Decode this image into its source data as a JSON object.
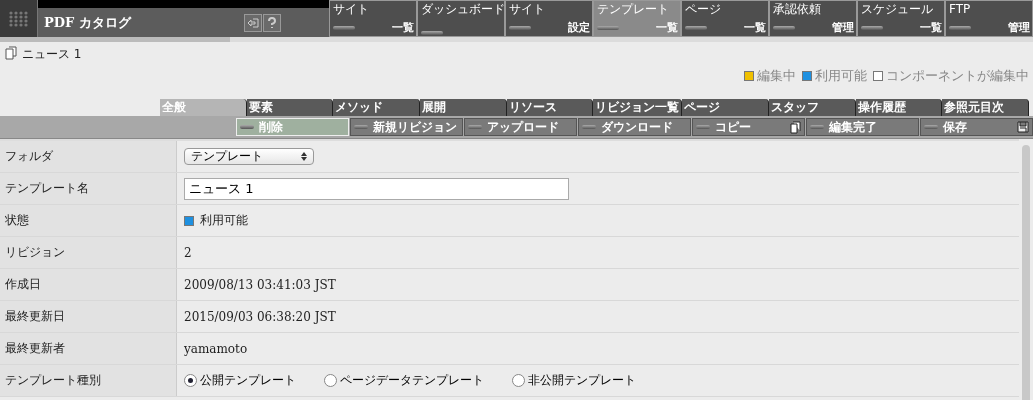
{
  "app": {
    "title": "PDF カタログ"
  },
  "nav": [
    {
      "label": "サイト",
      "sub": "一覧",
      "selected": false
    },
    {
      "label": "ダッシュボード",
      "selected": false
    },
    {
      "label": "サイト",
      "sub": "設定",
      "selected": false
    },
    {
      "label": "テンプレート",
      "sub": "一覧",
      "selected": true
    },
    {
      "label": "ページ",
      "sub": "一覧",
      "selected": false
    },
    {
      "label": "承認依頼",
      "sub": "管理",
      "selected": false
    },
    {
      "label": "スケジュール",
      "sub": "一覧",
      "selected": false
    },
    {
      "label": "FTP",
      "sub": "管理",
      "selected": false
    }
  ],
  "document": {
    "title": "ニュース 1"
  },
  "legend": [
    {
      "label": "編集中",
      "color": "#f0c000"
    },
    {
      "label": "利用可能",
      "color": "#1e90e0"
    },
    {
      "label": "コンポーネントが編集中",
      "color": "#ffffff"
    }
  ],
  "tabs": [
    {
      "label": "全般",
      "selected": true
    },
    {
      "label": "要素",
      "selected": false
    },
    {
      "label": "メソッド",
      "selected": false
    },
    {
      "label": "展開",
      "selected": false
    },
    {
      "label": "リソース",
      "selected": false
    },
    {
      "label": "リビジョン一覧",
      "selected": false
    },
    {
      "label": "ページ",
      "selected": false
    },
    {
      "label": "スタッフ",
      "selected": false
    },
    {
      "label": "操作履歴",
      "selected": false
    },
    {
      "label": "参照元目次",
      "selected": false
    }
  ],
  "actions": [
    {
      "label": "削除",
      "active": true,
      "kind": "plain"
    },
    {
      "label": "新規リビジョン",
      "active": false,
      "kind": "plain"
    },
    {
      "label": "アップロード",
      "active": false,
      "kind": "plain"
    },
    {
      "label": "ダウンロード",
      "active": false,
      "kind": "plain"
    },
    {
      "label": "コピー",
      "active": false,
      "kind": "copy"
    },
    {
      "label": "編集完了",
      "active": false,
      "kind": "plain"
    },
    {
      "label": "保存",
      "active": false,
      "kind": "save"
    }
  ],
  "fields": [
    {
      "kind": "select",
      "label": "フォルダ",
      "value": "テンプレート"
    },
    {
      "kind": "input",
      "label": "テンプレート名",
      "value": "ニュース 1"
    },
    {
      "kind": "status",
      "label": "状態",
      "value": "利用可能",
      "color": "#1e90e0"
    },
    {
      "kind": "text",
      "label": "リビジョン",
      "value": "2"
    },
    {
      "kind": "text",
      "label": "作成日",
      "value": "2009/08/13 03:41:03 JST"
    },
    {
      "kind": "text",
      "label": "最終更新日",
      "value": "2015/09/03 06:38:20 JST"
    },
    {
      "kind": "text",
      "label": "最終更新者",
      "value": "yamamoto"
    },
    {
      "kind": "radio",
      "label": "テンプレート種別",
      "options": [
        {
          "label": "公開テンプレート",
          "selected": true
        },
        {
          "label": "ページデータテンプレート",
          "selected": false
        },
        {
          "label": "非公開テンプレート",
          "selected": false
        }
      ]
    }
  ]
}
